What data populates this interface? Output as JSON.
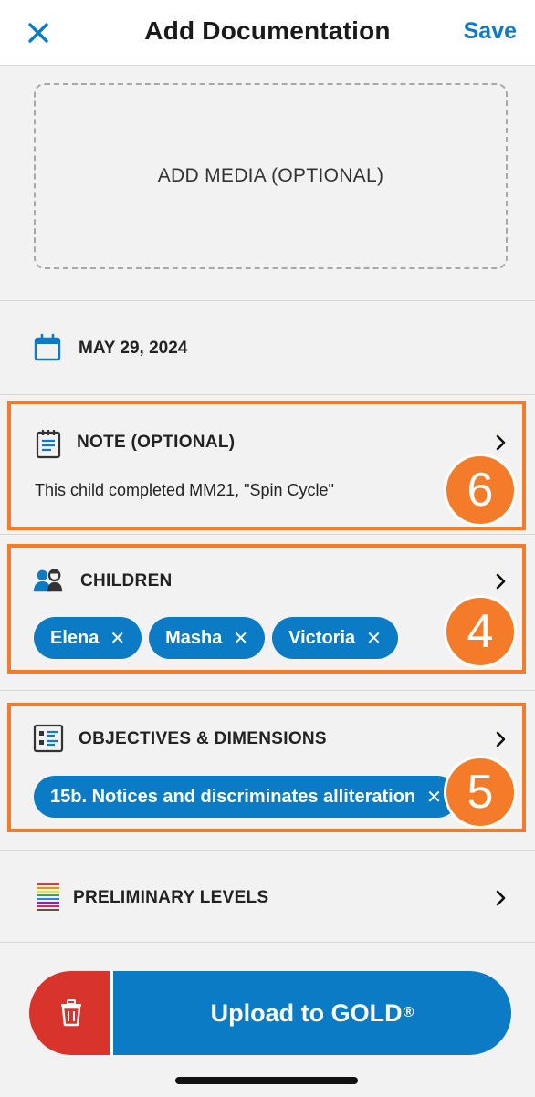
{
  "header": {
    "title": "Add Documentation",
    "save_label": "Save"
  },
  "media": {
    "label": "ADD MEDIA (OPTIONAL)"
  },
  "date": {
    "value": "MAY 29, 2024"
  },
  "note": {
    "title": "NOTE (OPTIONAL)",
    "text": "This child completed MM21, \"Spin Cycle\""
  },
  "children": {
    "title": "CHILDREN",
    "items": [
      {
        "label": "Elena"
      },
      {
        "label": "Masha"
      },
      {
        "label": "Victoria"
      }
    ]
  },
  "objectives": {
    "title": "OBJECTIVES & DIMENSIONS",
    "items": [
      {
        "label": "15b. Notices and discriminates alliteration"
      }
    ]
  },
  "levels": {
    "title": "PRELIMINARY LEVELS"
  },
  "actions": {
    "upload_label": "Upload to GOLD",
    "upload_mark": "®"
  },
  "callouts": {
    "note": "6",
    "children": "4",
    "objectives": "5"
  },
  "colors": {
    "accent": "#0a7bc4",
    "callout": "#f47b2a",
    "delete": "#d8342b"
  },
  "icons": {
    "close": "close-icon",
    "date": "calendar-icon",
    "note": "note-icon",
    "children": "children-icon",
    "objectives": "checklist-icon",
    "levels": "rainbow-lines-icon",
    "chevron": "chevron-right-icon",
    "delete": "trash-icon"
  }
}
